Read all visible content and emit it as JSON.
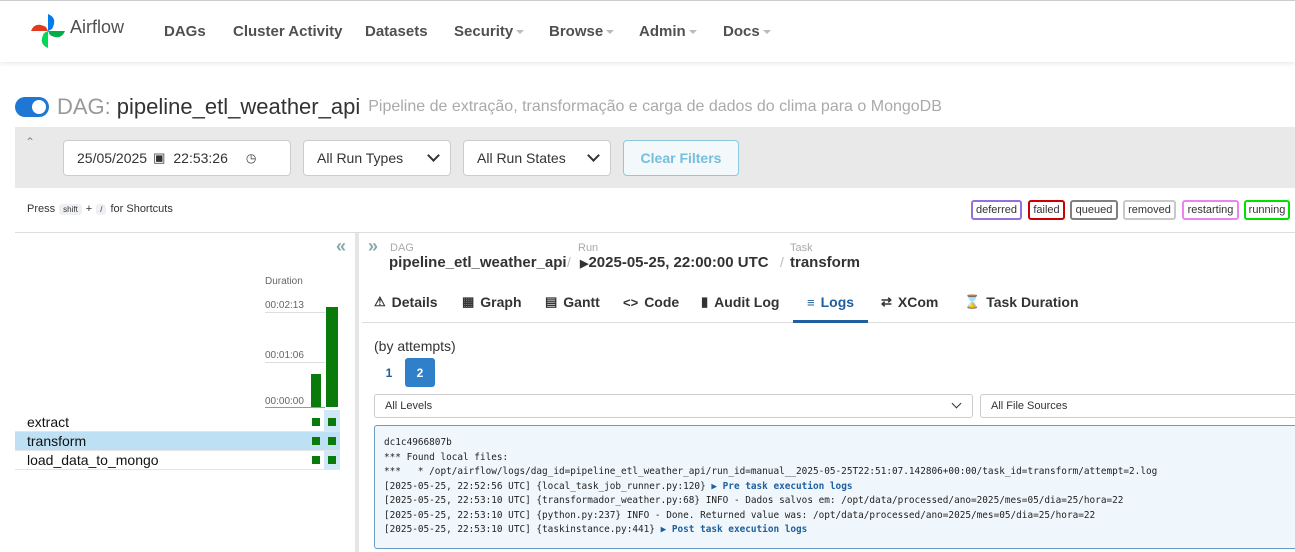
{
  "brand": {
    "name": "Airflow",
    "logo_colors": [
      "#017cee",
      "#00ad46",
      "#e43921",
      "#04d659"
    ]
  },
  "nav": [
    {
      "label": "DAGs",
      "dropdown": false
    },
    {
      "label": "Cluster Activity",
      "dropdown": false
    },
    {
      "label": "Datasets",
      "dropdown": false
    },
    {
      "label": "Security",
      "dropdown": true
    },
    {
      "label": "Browse",
      "dropdown": true
    },
    {
      "label": "Admin",
      "dropdown": true
    },
    {
      "label": "Docs",
      "dropdown": true
    }
  ],
  "dag": {
    "prefix": "DAG:",
    "name": "pipeline_etl_weather_api",
    "description": "Pipeline de extração, transformação e carga de dados do clima para o MongoDB",
    "paused": false
  },
  "filters": {
    "date": "25/05/2025",
    "time": "22:53:26",
    "run_types": "All Run Types",
    "run_states": "All Run States",
    "clear_label": "Clear Filters"
  },
  "shortcuts": {
    "press": "Press",
    "key1": "shift",
    "plus": "+",
    "key2": "/",
    "suffix": "for Shortcuts"
  },
  "states": [
    {
      "label": "deferred",
      "color": "#9370db"
    },
    {
      "label": "failed",
      "color": "#cc0000"
    },
    {
      "label": "queued",
      "color": "#808080"
    },
    {
      "label": "removed",
      "color": "#c8c8c8"
    },
    {
      "label": "restarting",
      "color": "#ee82ee"
    },
    {
      "label": "running",
      "color": "#00e000"
    }
  ],
  "grid": {
    "duration_label": "Duration",
    "ticks": [
      "00:02:13",
      "00:01:06",
      "00:00:00"
    ],
    "runs_duration_fraction": [
      0.33,
      1.0
    ],
    "tasks": [
      {
        "name": "extract",
        "selected": false
      },
      {
        "name": "transform",
        "selected": true
      },
      {
        "name": "load_data_to_mongo",
        "selected": false
      }
    ]
  },
  "breadcrumb": {
    "dag_label": "DAG",
    "dag_value": "pipeline_etl_weather_api",
    "run_label": "Run",
    "run_value": "2025-05-25, 22:00:00 UTC",
    "task_label": "Task",
    "task_value": "transform"
  },
  "tabs": [
    {
      "label": "Details",
      "icon": "⚠"
    },
    {
      "label": "Graph",
      "icon": "▦"
    },
    {
      "label": "Gantt",
      "icon": "▤"
    },
    {
      "label": "Code",
      "icon": "<>"
    },
    {
      "label": "Audit Log",
      "icon": "▮"
    },
    {
      "label": "Logs",
      "icon": "≡",
      "active": true
    },
    {
      "label": "XCom",
      "icon": "⇄"
    },
    {
      "label": "Task Duration",
      "icon": "⌛"
    }
  ],
  "logs": {
    "attempts_label": "(by attempts)",
    "attempts": [
      "1",
      "2"
    ],
    "active_attempt": "2",
    "level": "All Levels",
    "source": "All File Sources",
    "lines": [
      {
        "text": "dc1c4966807b"
      },
      {
        "text": "*** Found local files:"
      },
      {
        "text": "***   * /opt/airflow/logs/dag_id=pipeline_etl_weather_api/run_id=manual__2025-05-25T22:51:07.142806+00:00/task_id=transform/attempt=2.log"
      },
      {
        "text": "[2025-05-25, 22:52:56 UTC] {local_task_job_runner.py:120} ",
        "link": "▶ Pre task execution logs"
      },
      {
        "text": "[2025-05-25, 22:53:10 UTC] {transformador_weather.py:68} INFO - Dados salvos em: /opt/data/processed/ano=2025/mes=05/dia=25/hora=22"
      },
      {
        "text": "[2025-05-25, 22:53:10 UTC] {python.py:237} INFO - Done. Returned value was: /opt/data/processed/ano=2025/mes=05/dia=25/hora=22"
      },
      {
        "text": "[2025-05-25, 22:53:10 UTC] {taskinstance.py:441} ",
        "link": "▶ Post task execution logs"
      }
    ]
  }
}
